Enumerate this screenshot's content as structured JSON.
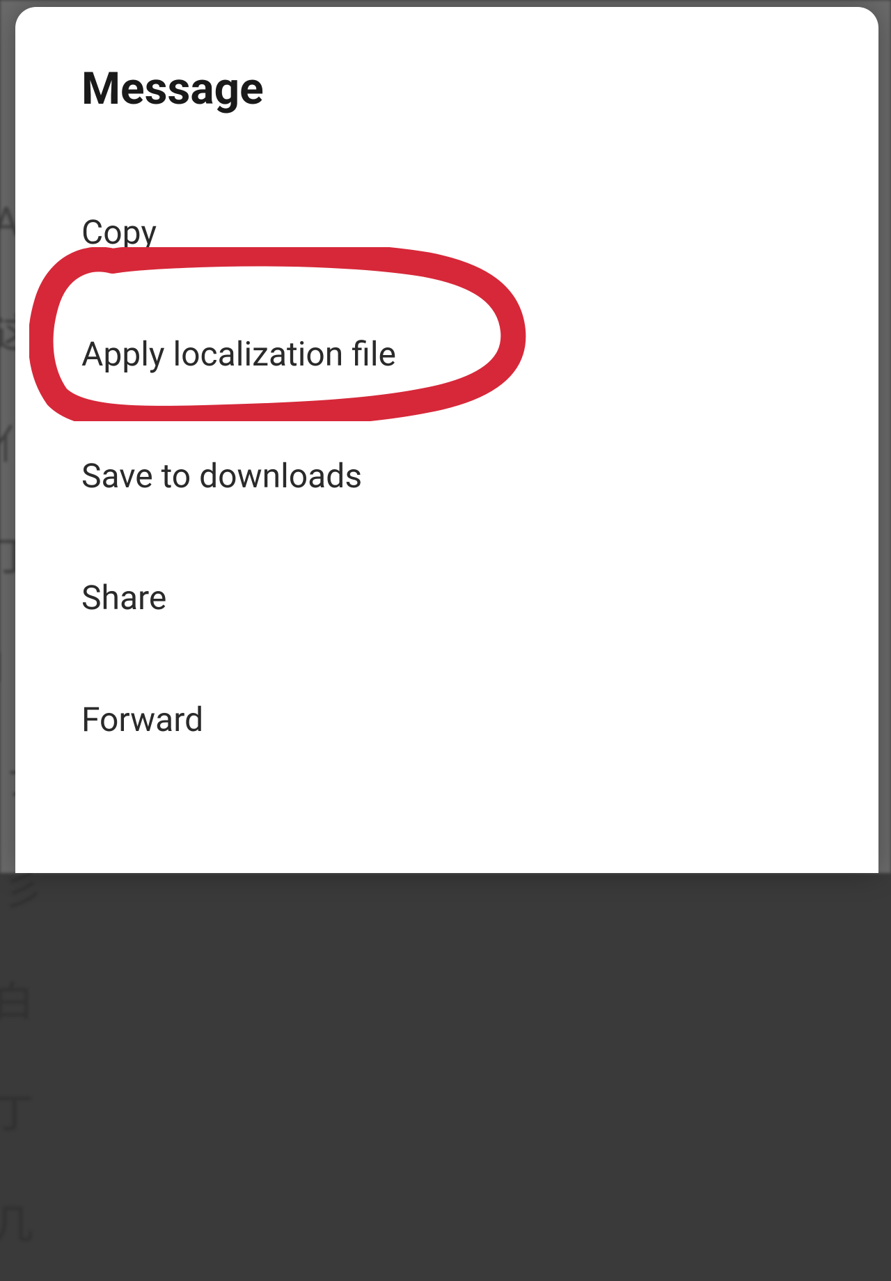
{
  "dialog": {
    "title": "Message",
    "menu_items": [
      {
        "label": "Copy"
      },
      {
        "label": "Apply localization file"
      },
      {
        "label": "Save to downloads"
      },
      {
        "label": "Share"
      },
      {
        "label": "Forward"
      }
    ]
  },
  "background": {
    "partial_text": "A\n这\n亻\n丁\nI\n ァ\n 彡\n白\n丁\n几"
  }
}
